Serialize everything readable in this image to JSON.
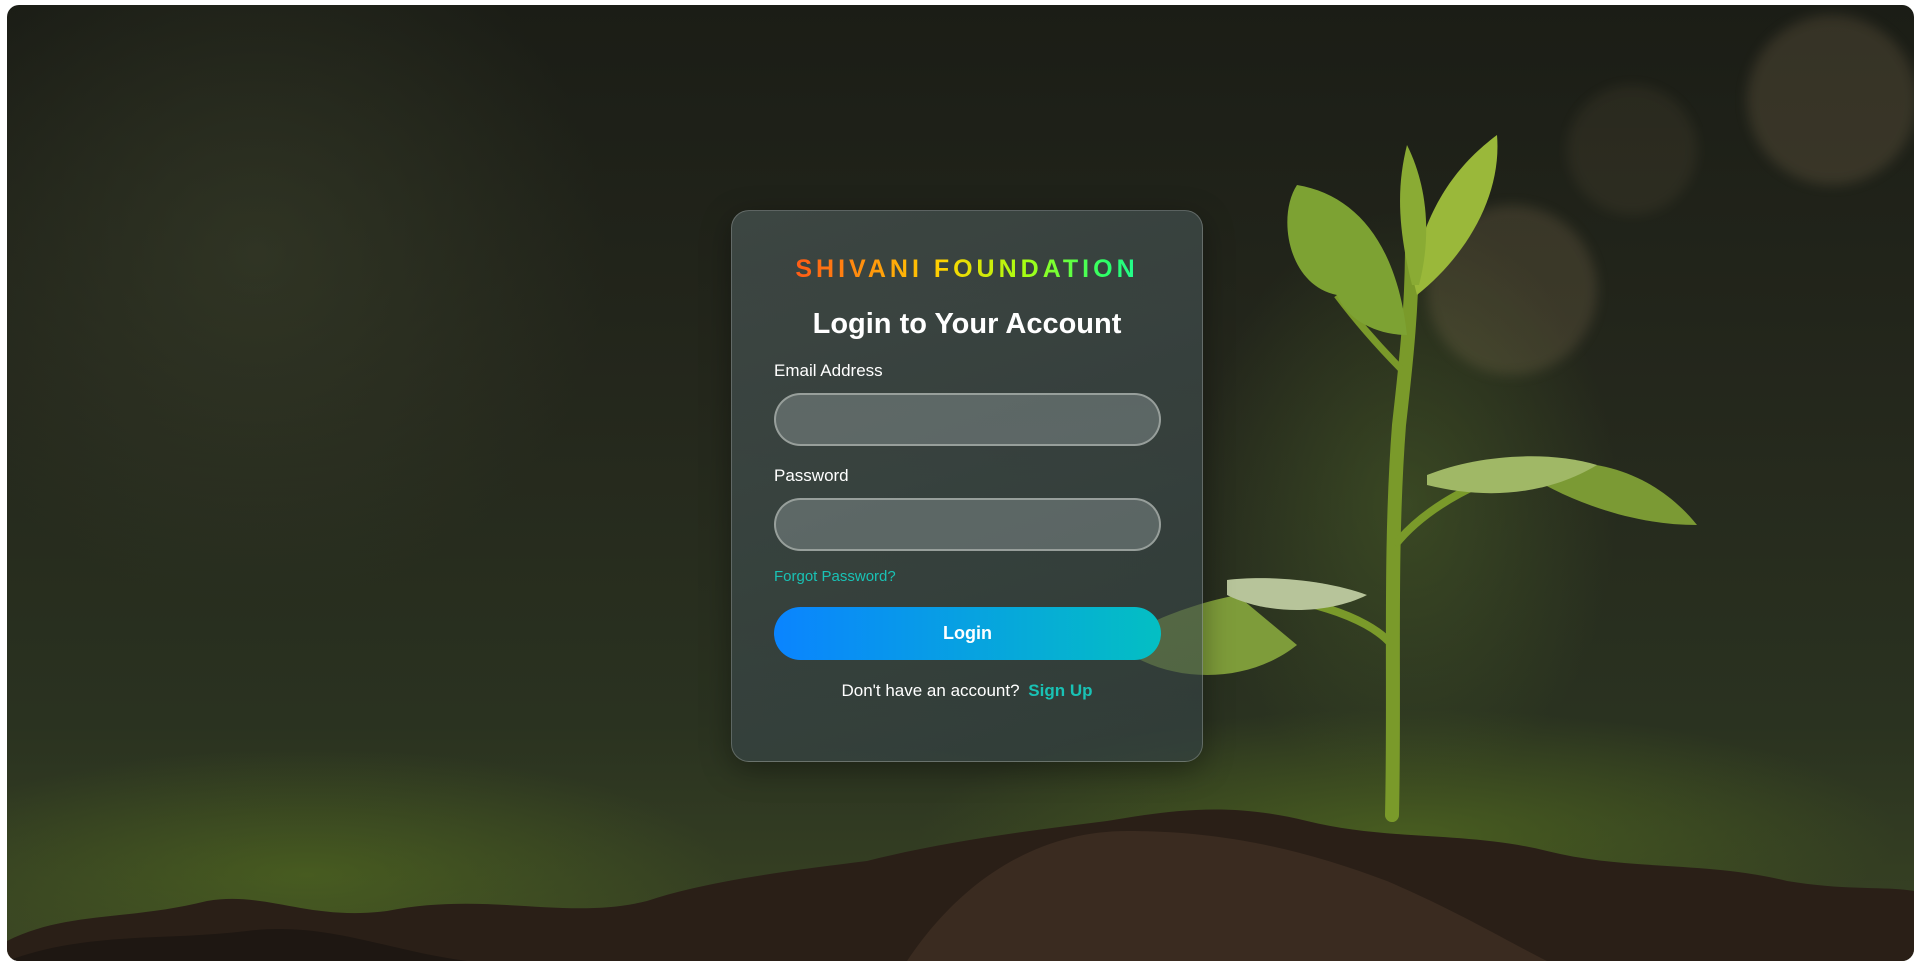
{
  "theme": {
    "accent": "#19c2b5",
    "button_gradient": [
      "#0a84ff",
      "#04bfc3"
    ],
    "brand_gradient": [
      "#ff2a1a",
      "#ff7a12",
      "#ffd400",
      "#a8ff12",
      "#2aff6a",
      "#12f0e0"
    ]
  },
  "background": {
    "description_icon": "seedling-in-soil-image"
  },
  "login_card": {
    "brand": "SHIVANI FOUNDATION",
    "heading": "Login to Your Account",
    "email": {
      "label": "Email Address",
      "value": "",
      "placeholder": ""
    },
    "password": {
      "label": "Password",
      "value": "",
      "placeholder": ""
    },
    "forgot_password": "Forgot Password?",
    "login_button": "Login",
    "signup_prompt": "Don't have an account?",
    "signup_link": "Sign Up"
  }
}
